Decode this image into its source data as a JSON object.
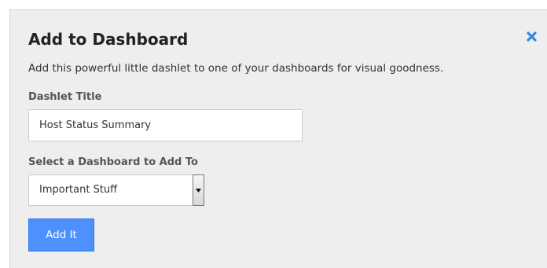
{
  "dialog": {
    "title": "Add to Dashboard",
    "description": "Add this powerful little dashlet to one of your dashboards for visual goodness.",
    "close_icon": "close-x-icon",
    "accent_color": "#4d90fe"
  },
  "form": {
    "dashlet_title_label": "Dashlet Title",
    "dashlet_title_value": "Host Status Summary",
    "dashboard_label": "Select a Dashboard to Add To",
    "dashboard_selected": "Important Stuff",
    "submit_label": "Add It"
  }
}
